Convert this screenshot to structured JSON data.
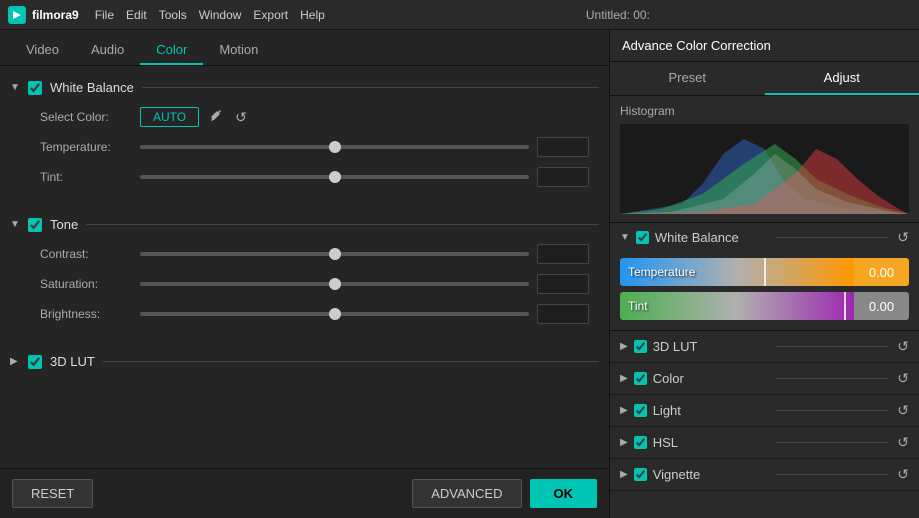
{
  "titlebar": {
    "logo": "f",
    "appname": "filmora9",
    "menus": [
      "File",
      "Edit",
      "Tools",
      "Window",
      "Export",
      "Help"
    ],
    "title": "Untitled: 00:"
  },
  "tabs": {
    "items": [
      "Video",
      "Audio",
      "Color",
      "Motion"
    ],
    "active": "Color"
  },
  "sections": [
    {
      "id": "white-balance",
      "title": "White Balance",
      "enabled": true,
      "expanded": true,
      "rows": [
        {
          "id": "select-color",
          "label": "Select Color:",
          "type": "auto-picker",
          "auto_label": "AUTO",
          "value": ""
        },
        {
          "id": "temperature",
          "label": "Temperature:",
          "type": "slider",
          "value": "0.00"
        },
        {
          "id": "tint",
          "label": "Tint:",
          "type": "slider",
          "value": "0.00"
        }
      ]
    },
    {
      "id": "tone",
      "title": "Tone",
      "enabled": true,
      "expanded": true,
      "rows": [
        {
          "id": "contrast",
          "label": "Contrast:",
          "type": "slider",
          "value": "0"
        },
        {
          "id": "saturation",
          "label": "Saturation:",
          "type": "slider",
          "value": "0"
        },
        {
          "id": "brightness",
          "label": "Brightness:",
          "type": "slider",
          "value": "0"
        }
      ]
    },
    {
      "id": "3d-lut",
      "title": "3D LUT",
      "enabled": true,
      "expanded": false,
      "rows": []
    }
  ],
  "buttons": {
    "reset": "RESET",
    "advanced": "ADVANCED",
    "ok": "OK"
  },
  "right_panel": {
    "title": "Advance Color Correction",
    "tabs": [
      "Preset",
      "Adjust"
    ],
    "active_tab": "Adjust",
    "histogram_label": "Histogram",
    "white_balance": {
      "title": "White Balance",
      "enabled": true,
      "temperature": {
        "label": "Temperature",
        "value": "0.00"
      },
      "tint": {
        "label": "Tint",
        "value": "0.00"
      }
    },
    "items": [
      {
        "id": "3d-lut",
        "label": "3D LUT",
        "enabled": true
      },
      {
        "id": "color",
        "label": "Color",
        "enabled": true
      },
      {
        "id": "light",
        "label": "Light",
        "enabled": true
      },
      {
        "id": "hsl",
        "label": "HSL",
        "enabled": true
      },
      {
        "id": "vignette",
        "label": "Vignette",
        "enabled": true
      }
    ]
  }
}
